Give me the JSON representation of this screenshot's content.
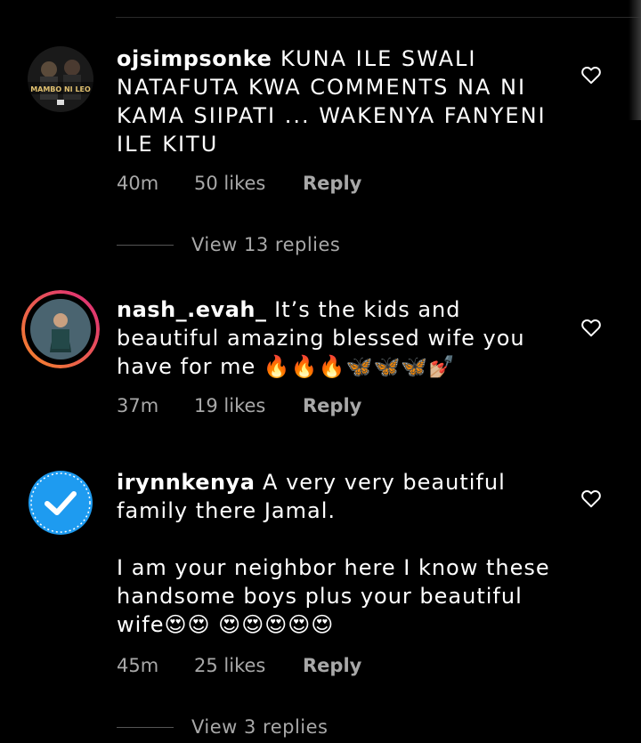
{
  "comments": [
    {
      "username": "ojsimpsonke",
      "text": "KUNA ILE SWALI NATAFUTA KWA COMMENTS NA NI KAMA SIIPATI ... WAKENYA FANYENI ILE KITU",
      "avatar_text": "MAMBO NI LEO",
      "time": "40m",
      "likes": "50 likes",
      "reply": "Reply",
      "view_replies": "View 13 replies"
    },
    {
      "username": "nash_.evah_",
      "text": "It’s the kids and beautiful amazing blessed wife you have for me 🔥🔥🔥🦋🦋🦋💅🏼",
      "time": "37m",
      "likes": "19 likes",
      "reply": "Reply"
    },
    {
      "username": "irynnkenya",
      "text": "A very very beautiful family there Jamal.\n\nI am your neighbor here I know these handsome boys plus your beautiful wife😍😍 😍😍😍😍😍",
      "time": "45m",
      "likes": "25 likes",
      "reply": "Reply",
      "view_replies": "View 3 replies"
    }
  ],
  "icons": {
    "like": "heart-outline-icon",
    "verified": "checkmark-badge-icon"
  },
  "colors": {
    "background": "#000000",
    "text": "#ffffff",
    "secondary_text": "#a8a8a8",
    "story_ring_start": "#f58529",
    "story_ring_end": "#dd2a7b",
    "verified_blue": "#1e9bf0"
  }
}
